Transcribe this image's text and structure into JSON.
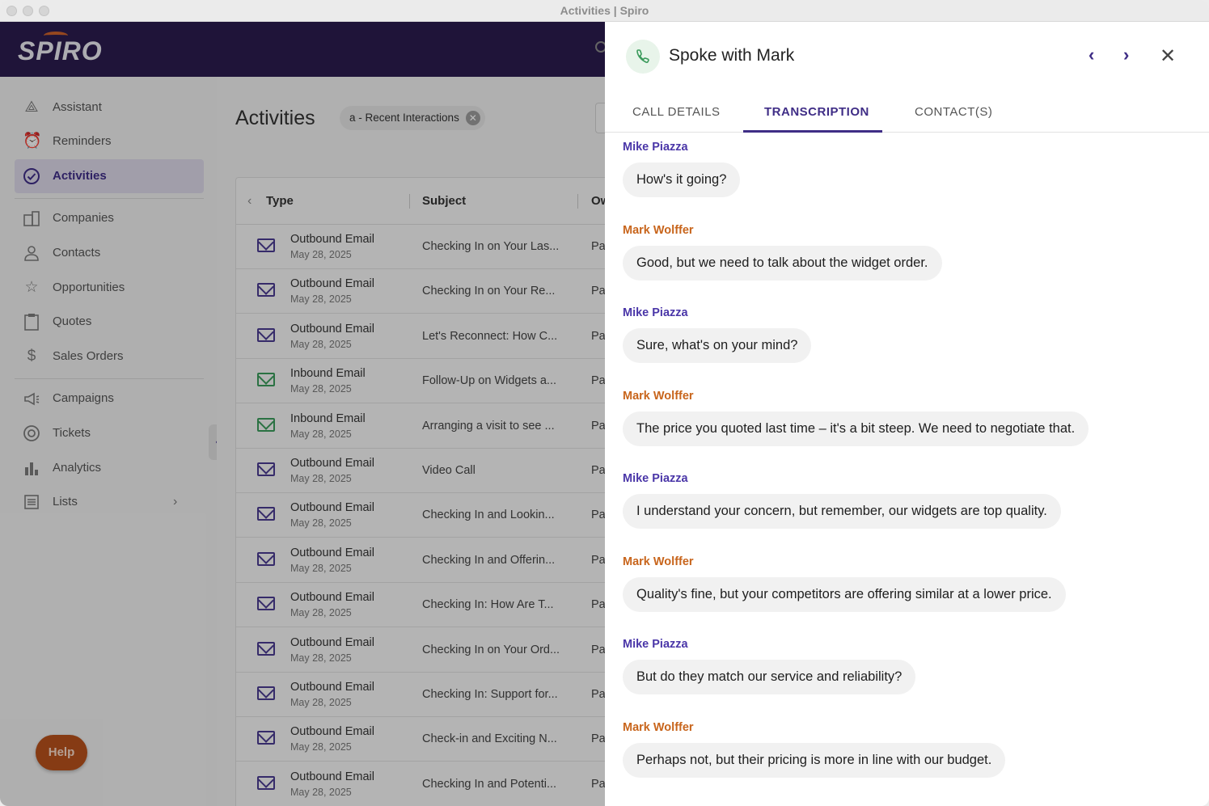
{
  "window": {
    "title": "Activities | Spiro"
  },
  "brand": {
    "logo_text": "SPIRO"
  },
  "sidebar": {
    "items": [
      {
        "label": "Assistant",
        "icon": "assistant-icon",
        "active": false
      },
      {
        "label": "Reminders",
        "icon": "alarm-clock-icon",
        "active": false
      },
      {
        "label": "Activities",
        "icon": "check-circle-icon",
        "active": true
      },
      {
        "label": "Companies",
        "icon": "building-icon",
        "active": false
      },
      {
        "label": "Contacts",
        "icon": "person-icon",
        "active": false
      },
      {
        "label": "Opportunities",
        "icon": "star-icon",
        "active": false
      },
      {
        "label": "Quotes",
        "icon": "clipboard-icon",
        "active": false
      },
      {
        "label": "Sales Orders",
        "icon": "dollar-icon",
        "active": false
      },
      {
        "label": "Campaigns",
        "icon": "megaphone-icon",
        "active": false
      },
      {
        "label": "Tickets",
        "icon": "lifebuoy-icon",
        "active": false
      },
      {
        "label": "Analytics",
        "icon": "bar-chart-icon",
        "active": false
      },
      {
        "label": "Lists",
        "icon": "list-icon",
        "active": false
      }
    ],
    "help_label": "Help"
  },
  "main": {
    "title": "Activities",
    "filter_chip": "a - Recent Interactions",
    "columns": [
      "Type",
      "Subject",
      "Ow"
    ],
    "rows": [
      {
        "type": "Outbound Email",
        "date": "May 28, 2025",
        "subject": "Checking In on Your Las...",
        "owner": "Pa"
      },
      {
        "type": "Outbound Email",
        "date": "May 28, 2025",
        "subject": "Checking In on Your Re...",
        "owner": "Pa"
      },
      {
        "type": "Outbound Email",
        "date": "May 28, 2025",
        "subject": "Let's Reconnect: How C...",
        "owner": "Pa"
      },
      {
        "type": "Inbound Email",
        "date": "May 28, 2025",
        "subject": "Follow-Up on Widgets a...",
        "owner": "Pa"
      },
      {
        "type": "Inbound Email",
        "date": "May 28, 2025",
        "subject": "Arranging a visit to see ...",
        "owner": "Pa"
      },
      {
        "type": "Outbound Email",
        "date": "May 28, 2025",
        "subject": "Video Call",
        "owner": "Pa"
      },
      {
        "type": "Outbound Email",
        "date": "May 28, 2025",
        "subject": "Checking In and Lookin...",
        "owner": "Pa"
      },
      {
        "type": "Outbound Email",
        "date": "May 28, 2025",
        "subject": "Checking In and Offerin...",
        "owner": "Pa"
      },
      {
        "type": "Outbound Email",
        "date": "May 28, 2025",
        "subject": "Checking In: How Are T...",
        "owner": "Pa"
      },
      {
        "type": "Outbound Email",
        "date": "May 28, 2025",
        "subject": "Checking In on Your Ord...",
        "owner": "Pa"
      },
      {
        "type": "Outbound Email",
        "date": "May 28, 2025",
        "subject": "Checking In: Support for...",
        "owner": "Pa"
      },
      {
        "type": "Outbound Email",
        "date": "May 28, 2025",
        "subject": "Check-in and Exciting N...",
        "owner": "Pa"
      },
      {
        "type": "Outbound Email",
        "date": "May 28, 2025",
        "subject": "Checking In and Potenti...",
        "owner": "Pa"
      }
    ]
  },
  "panel": {
    "title": "Spoke with Mark",
    "tabs": [
      "CALL DETAILS",
      "TRANSCRIPTION",
      "CONTACT(S)"
    ],
    "active_tab": "TRANSCRIPTION",
    "messages": [
      {
        "speaker": "Mike Piazza",
        "role": "mike",
        "text": "How's it going?"
      },
      {
        "speaker": "Mark Wolffer",
        "role": "mark",
        "text": "Good, but we need to talk about the widget order."
      },
      {
        "speaker": "Mike Piazza",
        "role": "mike",
        "text": "Sure, what's on your mind?"
      },
      {
        "speaker": "Mark Wolffer",
        "role": "mark",
        "text": "The price you quoted last time – it's a bit steep. We need to negotiate that."
      },
      {
        "speaker": "Mike Piazza",
        "role": "mike",
        "text": "I understand your concern, but remember, our widgets are top quality."
      },
      {
        "speaker": "Mark Wolffer",
        "role": "mark",
        "text": "Quality's fine, but your competitors are offering similar at a lower price."
      },
      {
        "speaker": "Mike Piazza",
        "role": "mike",
        "text": "But do they match our service and reliability?"
      },
      {
        "speaker": "Mark Wolffer",
        "role": "mark",
        "text": "Perhaps not, but their pricing is more in line with our budget."
      }
    ]
  },
  "colors": {
    "brand_dark": "#2b1c4e",
    "accent": "#3f2d86",
    "speaker_mike": "#4a36a8",
    "speaker_mark": "#c8651c",
    "help": "#b5501c"
  }
}
